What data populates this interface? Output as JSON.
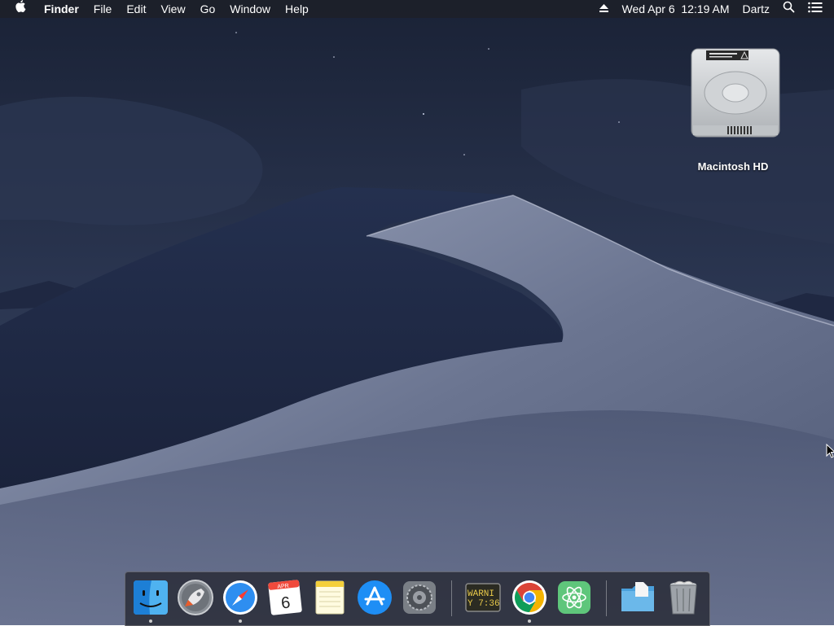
{
  "menubar": {
    "apple_icon": "apple-icon",
    "app_name": "Finder",
    "menus": [
      "File",
      "Edit",
      "View",
      "Go",
      "Window",
      "Help"
    ],
    "clock": "Wed Apr 6  12:19 AM",
    "user": "Dartz",
    "status_icons": [
      "eject-icon",
      "spotlight-search-icon",
      "notification-center-icon"
    ]
  },
  "desktop": {
    "disk_label": "Macintosh HD"
  },
  "dock": {
    "items": [
      {
        "name": "Finder",
        "icon": "finder-icon",
        "running": true
      },
      {
        "name": "Launchpad",
        "icon": "launchpad-icon",
        "running": false
      },
      {
        "name": "Safari",
        "icon": "safari-icon",
        "running": true
      },
      {
        "name": "Calendar",
        "icon": "calendar-icon",
        "running": false,
        "month": "APR",
        "day": "6"
      },
      {
        "name": "Notes",
        "icon": "notes-icon",
        "running": false
      },
      {
        "name": "App Store",
        "icon": "app-store-icon",
        "running": false
      },
      {
        "name": "System Preferences",
        "icon": "system-preferences-icon",
        "running": false
      },
      {
        "name": "Console",
        "icon": "console-icon",
        "running": false,
        "line1": "WARNI",
        "line2": "Y 7:36"
      },
      {
        "name": "Google Chrome",
        "icon": "chrome-icon",
        "running": true
      },
      {
        "name": "Atom",
        "icon": "atom-icon",
        "running": false
      },
      {
        "name": "Downloads",
        "icon": "folder-icon",
        "running": false
      },
      {
        "name": "Trash",
        "icon": "trash-icon",
        "running": false
      }
    ]
  },
  "colors": {
    "sky_top": "#1b2438",
    "dune_light": "#8a94ad",
    "dune_dark": "#1e2640",
    "menubar": "#1e2026"
  }
}
